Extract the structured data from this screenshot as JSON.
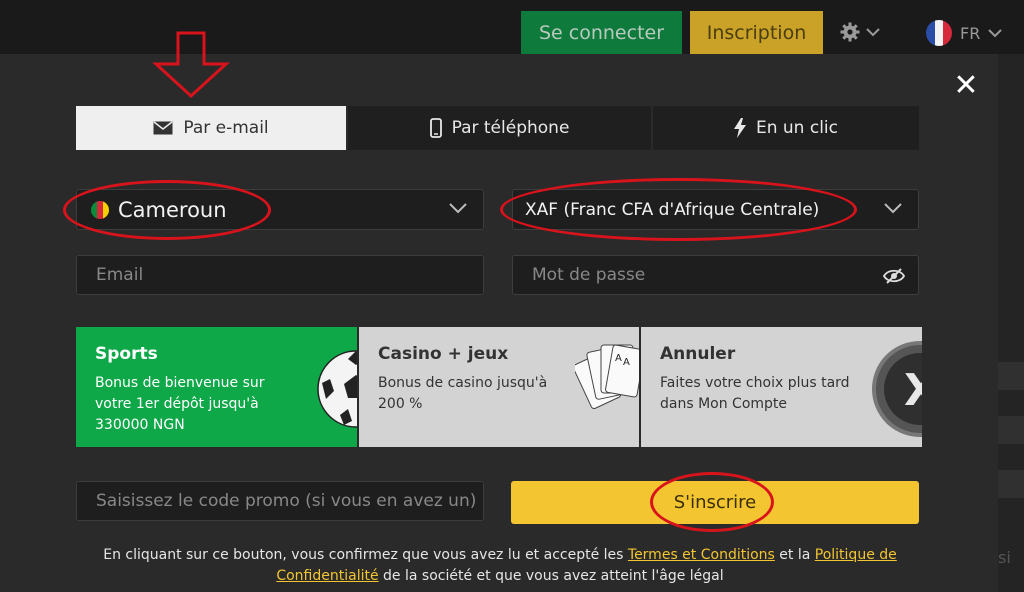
{
  "header": {
    "login_label": "Se connecter",
    "register_label": "Inscription",
    "settings_icon": "gear-icon",
    "language": "FR"
  },
  "modal": {
    "close_icon": "close-icon",
    "tabs": [
      {
        "label": "Par e-mail",
        "icon": "envelope-icon",
        "active": true
      },
      {
        "label": "Par téléphone",
        "icon": "phone-icon",
        "active": false
      },
      {
        "label": "En un clic",
        "icon": "lightning-icon",
        "active": false
      }
    ],
    "country": {
      "value": "Cameroun",
      "flag": "cameroon-flag-icon"
    },
    "currency": {
      "value": "XAF (Franc CFA d'Afrique Centrale)"
    },
    "email": {
      "placeholder": "Email"
    },
    "password": {
      "placeholder": "Mot de passe"
    },
    "bonuses": [
      {
        "title": "Sports",
        "description": "Bonus de bienvenue sur votre 1er dépôt jusqu'à 330000 NGN",
        "selected": true
      },
      {
        "title": "Casino + jeux",
        "description": "Bonus de casino jusqu'à 200 %",
        "selected": false
      },
      {
        "title": "Annuler",
        "description": "Faites votre choix plus tard dans Mon Compte",
        "selected": false
      }
    ],
    "promo": {
      "placeholder": "Saisissez le code promo (si vous en avez un)"
    },
    "submit_label": "S'inscrire",
    "legal": {
      "part1": "En cliquant sur ce bouton, vous confirmez que vous avez lu et accepté les ",
      "terms_link": "Termes et Conditions",
      "part2": " et la ",
      "privacy_link": "Politique de Confidentialité",
      "part3": " de la société et que vous avez atteint l'âge légal"
    }
  },
  "background": {
    "partial_text": "si"
  },
  "colors": {
    "green": "#0ea849",
    "yellow": "#f3c530",
    "annotation_red": "#d9131b"
  }
}
